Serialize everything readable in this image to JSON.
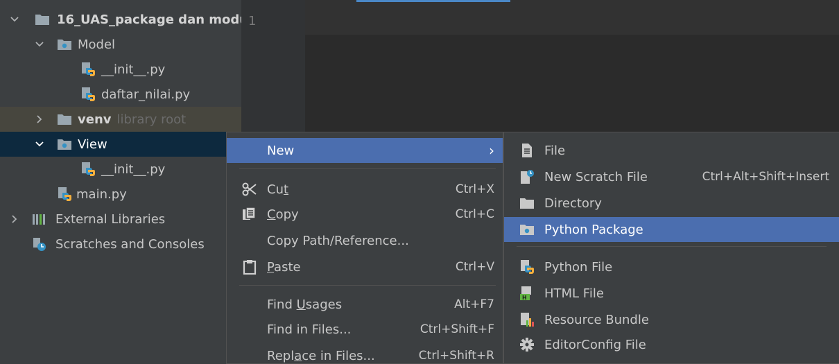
{
  "tree": {
    "items": [
      {
        "label": "16_UAS_package dan modu",
        "hint": ""
      },
      {
        "label": "Model",
        "hint": ""
      },
      {
        "label": "__init__.py",
        "hint": ""
      },
      {
        "label": "daftar_nilai.py",
        "hint": ""
      },
      {
        "label": "venv",
        "hint": "library root"
      },
      {
        "label": "View",
        "hint": ""
      },
      {
        "label": "__init__.py",
        "hint": ""
      },
      {
        "label": "main.py",
        "hint": ""
      },
      {
        "label": "External Libraries",
        "hint": ""
      },
      {
        "label": "Scratches and Consoles",
        "hint": ""
      }
    ]
  },
  "editor": {
    "line_number": "1"
  },
  "menu1": {
    "new": {
      "label": "New"
    },
    "cut": {
      "pre": "Cu",
      "mn": "t",
      "post": "",
      "shortcut": "Ctrl+X"
    },
    "copy": {
      "pre": "",
      "mn": "C",
      "post": "opy",
      "shortcut": "Ctrl+C"
    },
    "copy_path": {
      "label": "Copy Path/Reference..."
    },
    "paste": {
      "pre": "",
      "mn": "P",
      "post": "aste",
      "shortcut": "Ctrl+V"
    },
    "find_usages": {
      "pre": "Find ",
      "mn": "U",
      "post": "sages",
      "shortcut": "Alt+F7"
    },
    "find_in_files": {
      "label": "Find in Files...",
      "shortcut": "Ctrl+Shift+F"
    },
    "replace_in_files": {
      "pre": "Repl",
      "mn": "a",
      "post": "ce in Files...",
      "shortcut": "Ctrl+Shift+R"
    }
  },
  "menu2": {
    "file": {
      "label": "File"
    },
    "scratch": {
      "label": "New Scratch File",
      "shortcut": "Ctrl+Alt+Shift+Insert"
    },
    "directory": {
      "label": "Directory"
    },
    "python_package": {
      "label": "Python Package"
    },
    "python_file": {
      "label": "Python File"
    },
    "html_file": {
      "label": "HTML File"
    },
    "resource_bundle": {
      "label": "Resource Bundle"
    },
    "editorconfig": {
      "label": "EditorConfig File"
    }
  },
  "colors": {
    "highlight": "#4b6eaf",
    "tree_selection": "#0d293e",
    "background": "#3c3f41",
    "editor": "#2b2b2b"
  }
}
